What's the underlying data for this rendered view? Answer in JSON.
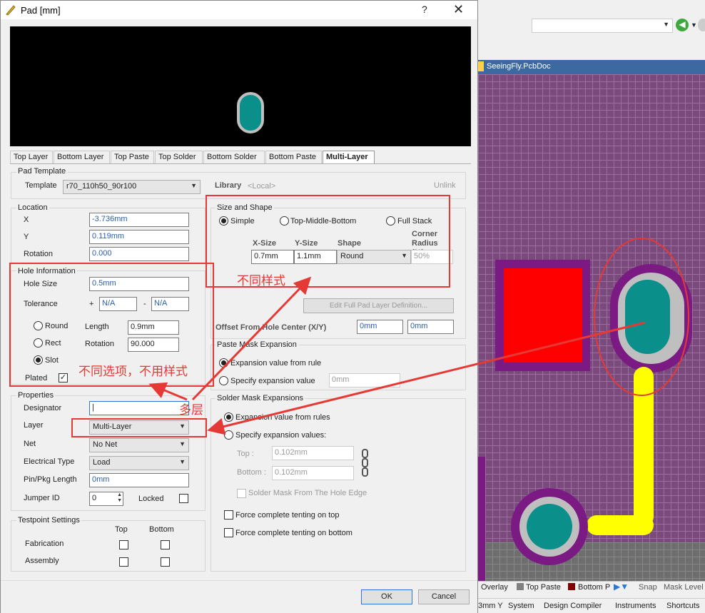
{
  "dialog": {
    "title": "Pad [mm]",
    "help": "?",
    "close": "✕",
    "tabs": [
      "Top Layer",
      "Bottom Layer",
      "Top Paste",
      "Top Solder",
      "Bottom Solder",
      "Bottom Paste",
      "Multi-Layer"
    ],
    "active_tab": "Multi-Layer"
  },
  "pad_template": {
    "group": "Pad Template",
    "template_label": "Template",
    "template_value": "r70_110h50_90r100",
    "library_label": "Library",
    "library_value": "<Local>",
    "unlink": "Unlink"
  },
  "location": {
    "group": "Location",
    "x_label": "X",
    "x_value": "-3.736mm",
    "y_label": "Y",
    "y_value": "0.119mm",
    "rot_label": "Rotation",
    "rot_value": "0.000"
  },
  "hole": {
    "group": "Hole Information",
    "size_label": "Hole Size",
    "size_value": "0.5mm",
    "tol_label": "Tolerance",
    "tol_plus": "+",
    "tol_plus_value": "N/A",
    "tol_minus": "-",
    "tol_minus_value": "N/A",
    "round": "Round",
    "rect": "Rect",
    "slot": "Slot",
    "length_label": "Length",
    "length_value": "0.9mm",
    "rotation_label": "Rotation",
    "rotation_value": "90.000",
    "plated_label": "Plated",
    "plated_check": "✓"
  },
  "properties": {
    "group": "Properties",
    "designator_label": "Designator",
    "designator_value": "|",
    "layer_label": "Layer",
    "layer_value": "Multi-Layer",
    "net_label": "Net",
    "net_value": "No Net",
    "etype_label": "Electrical Type",
    "etype_value": "Load",
    "pinpkg_label": "Pin/Pkg Length",
    "pinpkg_value": "0mm",
    "jumper_label": "Jumper ID",
    "jumper_value": "0",
    "locked_label": "Locked"
  },
  "testpoint": {
    "group": "Testpoint Settings",
    "top": "Top",
    "bottom": "Bottom",
    "fabrication": "Fabrication",
    "assembly": "Assembly"
  },
  "size_shape": {
    "group": "Size and Shape",
    "simple": "Simple",
    "tmb": "Top-Middle-Bottom",
    "full": "Full Stack",
    "col_x": "X-Size",
    "col_y": "Y-Size",
    "col_shape": "Shape",
    "col_corner": "Corner Radius (%)",
    "x_value": "0.7mm",
    "y_value": "1.1mm",
    "shape_value": "Round",
    "corner_value": "50%",
    "edit_btn": "Edit Full Pad Layer Definition...",
    "offset_label": "Offset From Hole Center (X/Y)",
    "offset_x": "0mm",
    "offset_y": "0mm"
  },
  "paste": {
    "group": "Paste Mask Expansion",
    "opt_rule": "Expansion value from rule",
    "opt_specify": "Specify expansion value",
    "value": "0mm"
  },
  "solder": {
    "group": "Solder Mask Expansions",
    "opt_rule": "Expansion value from rules",
    "opt_specify": "Specify expansion values:",
    "top_label": "Top :",
    "top_value": "0.102mm",
    "bottom_label": "Bottom :",
    "bottom_value": "0.102mm",
    "from_hole": "Solder Mask From The Hole Edge",
    "tent_top": "Force complete tenting on top",
    "tent_bottom": "Force complete tenting on bottom"
  },
  "buttons": {
    "ok": "OK",
    "cancel": "Cancel"
  },
  "annotations": {
    "style": "不同样式",
    "options": "不同选项，不用样式",
    "multilayer": "多层"
  },
  "pcb": {
    "doc_tab": "SeeingFly.PcbDoc",
    "layer_tabs": [
      "Overlay",
      "Top Paste",
      "Bottom P"
    ],
    "snap": "Snap",
    "mask_level": "Mask Level",
    "status_tabs": [
      "System",
      "Design Compiler",
      "Instruments",
      "Shortcuts"
    ],
    "coord": "3mm Y"
  },
  "colors": {
    "annotation": "#e53935",
    "pad": "#0a8f8a",
    "mask": "#7b1a82",
    "track": "#ffff00",
    "copper": "#ff0000"
  }
}
